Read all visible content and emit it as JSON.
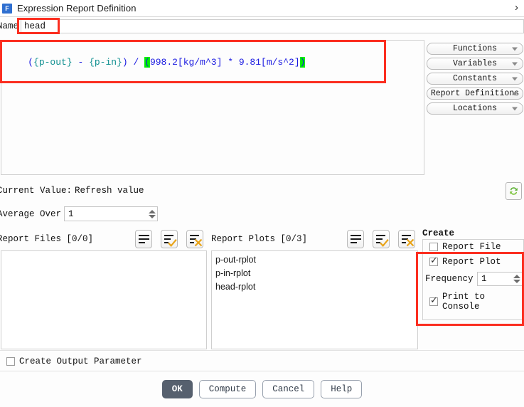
{
  "window": {
    "title": "Expression Report Definition",
    "app_icon": "fluent-f-icon",
    "expand_chevron": "›"
  },
  "name_field": {
    "label": "Name",
    "value": "head"
  },
  "expression": {
    "tokens": [
      {
        "text": "(",
        "style": "op"
      },
      {
        "text": "{p-out}",
        "style": "var"
      },
      {
        "text": " ",
        "style": "plain"
      },
      {
        "text": "-",
        "style": "op"
      },
      {
        "text": " ",
        "style": "plain"
      },
      {
        "text": "{p-in}",
        "style": "var"
      },
      {
        "text": ")",
        "style": "op"
      },
      {
        "text": " ",
        "style": "plain"
      },
      {
        "text": "/",
        "style": "op"
      },
      {
        "text": " ",
        "style": "plain"
      },
      {
        "text": "(",
        "style": "hl"
      },
      {
        "text": "998.2[kg/m^3]",
        "style": "num"
      },
      {
        "text": " ",
        "style": "plain"
      },
      {
        "text": "*",
        "style": "op"
      },
      {
        "text": " ",
        "style": "plain"
      },
      {
        "text": "9.81[m/s^2]",
        "style": "num"
      },
      {
        "text": ")",
        "style": "hl"
      }
    ],
    "plain_text": "({p-out} - {p-in}) / (998.2[kg/m^3] * 9.81[m/s^2])"
  },
  "insert_menus": [
    {
      "label": "Functions",
      "icon": "chevron-down-icon"
    },
    {
      "label": "Variables",
      "icon": "chevron-down-icon"
    },
    {
      "label": "Constants",
      "icon": "chevron-down-icon"
    },
    {
      "label": "Report Definitions",
      "icon": "chevron-down-icon"
    },
    {
      "label": "Locations",
      "icon": "chevron-down-icon"
    }
  ],
  "current_value": {
    "label": "Current Value:",
    "refresh_link": "Refresh value",
    "refresh_icon": "refresh-green-icon"
  },
  "average_over": {
    "label": "Average Over",
    "value": "1"
  },
  "report_files": {
    "label": "Report Files [0/0]",
    "items": [],
    "toolbar": [
      {
        "name": "select-all-icon"
      },
      {
        "name": "check-all-icon"
      },
      {
        "name": "clear-all-icon"
      }
    ]
  },
  "report_plots": {
    "label": "Report Plots [0/3]",
    "items": [
      "p-out-rplot",
      "p-in-rplot",
      "head-rplot"
    ],
    "toolbar": [
      {
        "name": "select-all-icon"
      },
      {
        "name": "check-all-icon"
      },
      {
        "name": "clear-all-icon"
      }
    ]
  },
  "create": {
    "title": "Create",
    "report_file": {
      "label": "Report File",
      "checked": false
    },
    "report_plot": {
      "label": "Report Plot",
      "checked": true
    },
    "frequency": {
      "label": "Frequency",
      "value": "1"
    },
    "print_to_console": {
      "label": "Print to Console",
      "checked": true
    }
  },
  "output_parameter": {
    "label": "Create Output Parameter",
    "checked": false
  },
  "buttons": {
    "ok": "OK",
    "compute": "Compute",
    "cancel": "Cancel",
    "help": "Help"
  },
  "annotations": {
    "color": "#fb2e20",
    "regions": [
      "name-field",
      "expression-editor",
      "create-options"
    ]
  }
}
